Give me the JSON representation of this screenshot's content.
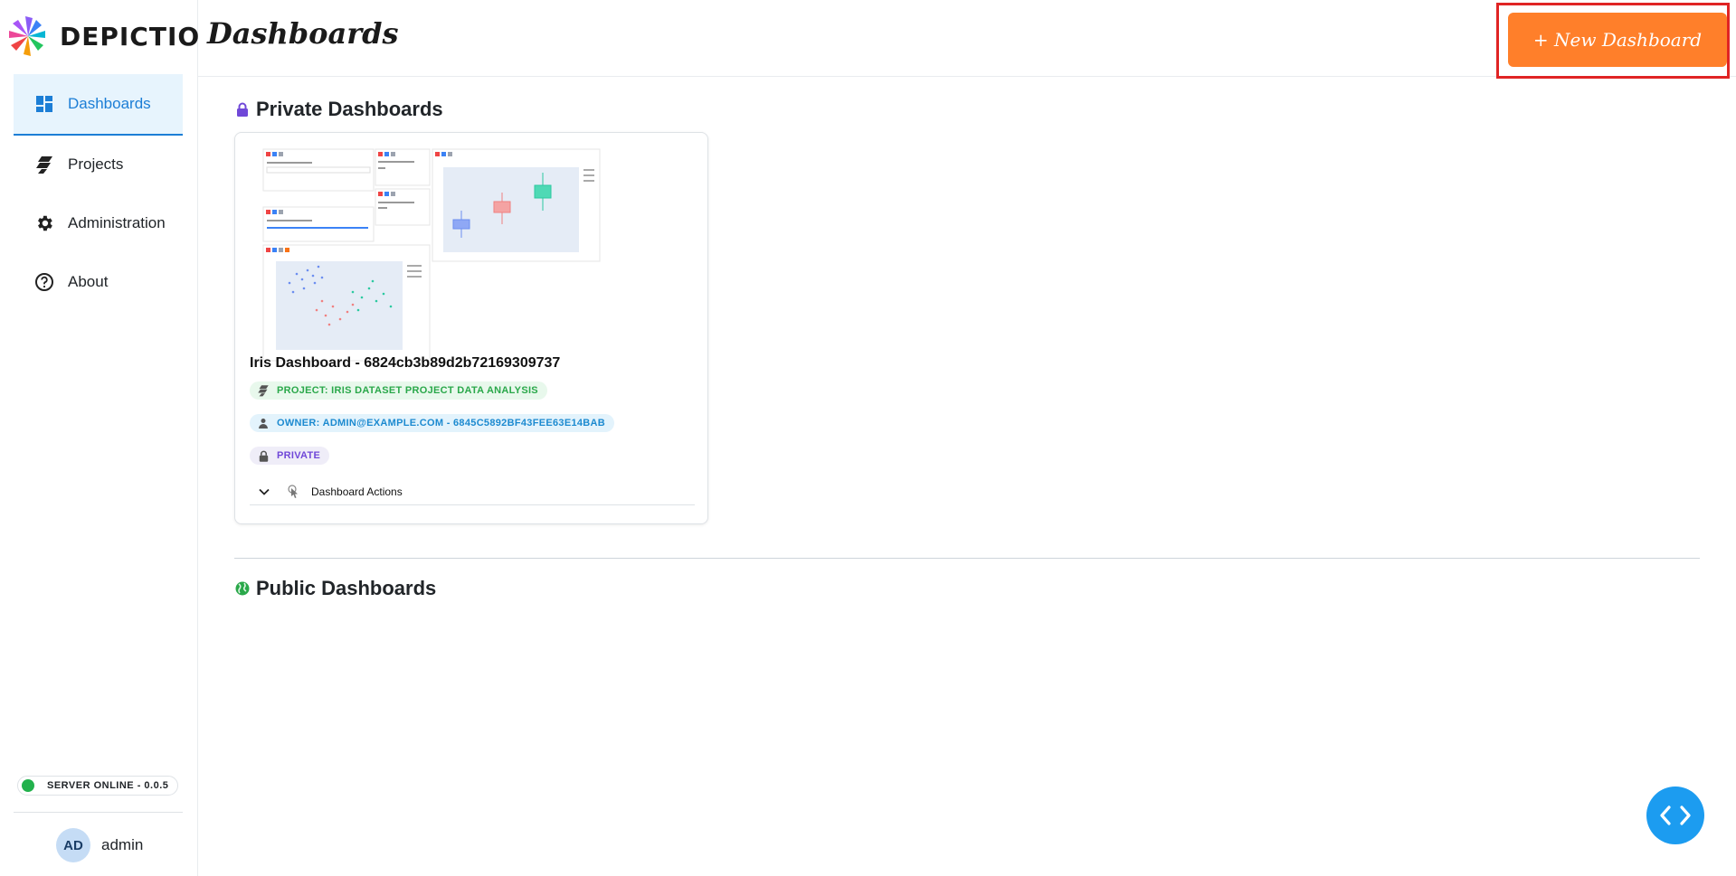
{
  "brand": {
    "name": "DEPICTIO",
    "logo_colors": [
      "#8b5cf6",
      "#3b82f6",
      "#22c55e",
      "#f59e0b",
      "#ef4444",
      "#ec4899"
    ]
  },
  "header": {
    "title": "Dashboards",
    "new_button_label": "+ New Dashboard"
  },
  "sidebar": {
    "items": [
      {
        "label": "Dashboards",
        "icon": "dashboard-icon",
        "active": true
      },
      {
        "label": "Projects",
        "icon": "projects-icon",
        "active": false
      },
      {
        "label": "Administration",
        "icon": "gear-icon",
        "active": false
      },
      {
        "label": "About",
        "icon": "help-circle-icon",
        "active": false
      }
    ],
    "server_status": "SERVER ONLINE - 0.0.5",
    "user": {
      "initials": "AD",
      "name": "admin"
    }
  },
  "private_section": {
    "title": "Private Dashboards",
    "icon": "lock-icon"
  },
  "dashboard_card": {
    "title": "Iris Dashboard - 6824cb3b89d2b72169309737",
    "project_badge": "PROJECT: IRIS DATASET PROJECT DATA ANALYSIS",
    "owner_badge": "OWNER: ADMIN@EXAMPLE.COM - 6845C5892BF43FEE63E14BAB",
    "visibility_badge": "PRIVATE",
    "actions_label": "Dashboard Actions"
  },
  "public_section": {
    "title": "Public Dashboards",
    "icon": "globe-icon"
  },
  "colors": {
    "accent": "#1c7ed6",
    "new_button": "#ff7f2a",
    "status_online": "#22b14c",
    "fab": "#1c9cf0"
  }
}
